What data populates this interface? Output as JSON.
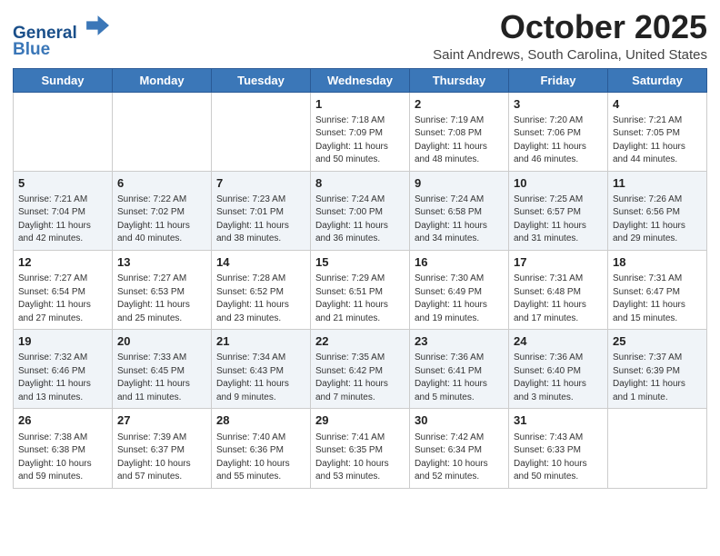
{
  "header": {
    "logo_line1": "General",
    "logo_line2": "Blue",
    "main_title": "October 2025",
    "subtitle": "Saint Andrews, South Carolina, United States"
  },
  "weekdays": [
    "Sunday",
    "Monday",
    "Tuesday",
    "Wednesday",
    "Thursday",
    "Friday",
    "Saturday"
  ],
  "weeks": [
    [
      {
        "day": "",
        "info": ""
      },
      {
        "day": "",
        "info": ""
      },
      {
        "day": "",
        "info": ""
      },
      {
        "day": "1",
        "info": "Sunrise: 7:18 AM\nSunset: 7:09 PM\nDaylight: 11 hours\nand 50 minutes."
      },
      {
        "day": "2",
        "info": "Sunrise: 7:19 AM\nSunset: 7:08 PM\nDaylight: 11 hours\nand 48 minutes."
      },
      {
        "day": "3",
        "info": "Sunrise: 7:20 AM\nSunset: 7:06 PM\nDaylight: 11 hours\nand 46 minutes."
      },
      {
        "day": "4",
        "info": "Sunrise: 7:21 AM\nSunset: 7:05 PM\nDaylight: 11 hours\nand 44 minutes."
      }
    ],
    [
      {
        "day": "5",
        "info": "Sunrise: 7:21 AM\nSunset: 7:04 PM\nDaylight: 11 hours\nand 42 minutes."
      },
      {
        "day": "6",
        "info": "Sunrise: 7:22 AM\nSunset: 7:02 PM\nDaylight: 11 hours\nand 40 minutes."
      },
      {
        "day": "7",
        "info": "Sunrise: 7:23 AM\nSunset: 7:01 PM\nDaylight: 11 hours\nand 38 minutes."
      },
      {
        "day": "8",
        "info": "Sunrise: 7:24 AM\nSunset: 7:00 PM\nDaylight: 11 hours\nand 36 minutes."
      },
      {
        "day": "9",
        "info": "Sunrise: 7:24 AM\nSunset: 6:58 PM\nDaylight: 11 hours\nand 34 minutes."
      },
      {
        "day": "10",
        "info": "Sunrise: 7:25 AM\nSunset: 6:57 PM\nDaylight: 11 hours\nand 31 minutes."
      },
      {
        "day": "11",
        "info": "Sunrise: 7:26 AM\nSunset: 6:56 PM\nDaylight: 11 hours\nand 29 minutes."
      }
    ],
    [
      {
        "day": "12",
        "info": "Sunrise: 7:27 AM\nSunset: 6:54 PM\nDaylight: 11 hours\nand 27 minutes."
      },
      {
        "day": "13",
        "info": "Sunrise: 7:27 AM\nSunset: 6:53 PM\nDaylight: 11 hours\nand 25 minutes."
      },
      {
        "day": "14",
        "info": "Sunrise: 7:28 AM\nSunset: 6:52 PM\nDaylight: 11 hours\nand 23 minutes."
      },
      {
        "day": "15",
        "info": "Sunrise: 7:29 AM\nSunset: 6:51 PM\nDaylight: 11 hours\nand 21 minutes."
      },
      {
        "day": "16",
        "info": "Sunrise: 7:30 AM\nSunset: 6:49 PM\nDaylight: 11 hours\nand 19 minutes."
      },
      {
        "day": "17",
        "info": "Sunrise: 7:31 AM\nSunset: 6:48 PM\nDaylight: 11 hours\nand 17 minutes."
      },
      {
        "day": "18",
        "info": "Sunrise: 7:31 AM\nSunset: 6:47 PM\nDaylight: 11 hours\nand 15 minutes."
      }
    ],
    [
      {
        "day": "19",
        "info": "Sunrise: 7:32 AM\nSunset: 6:46 PM\nDaylight: 11 hours\nand 13 minutes."
      },
      {
        "day": "20",
        "info": "Sunrise: 7:33 AM\nSunset: 6:45 PM\nDaylight: 11 hours\nand 11 minutes."
      },
      {
        "day": "21",
        "info": "Sunrise: 7:34 AM\nSunset: 6:43 PM\nDaylight: 11 hours\nand 9 minutes."
      },
      {
        "day": "22",
        "info": "Sunrise: 7:35 AM\nSunset: 6:42 PM\nDaylight: 11 hours\nand 7 minutes."
      },
      {
        "day": "23",
        "info": "Sunrise: 7:36 AM\nSunset: 6:41 PM\nDaylight: 11 hours\nand 5 minutes."
      },
      {
        "day": "24",
        "info": "Sunrise: 7:36 AM\nSunset: 6:40 PM\nDaylight: 11 hours\nand 3 minutes."
      },
      {
        "day": "25",
        "info": "Sunrise: 7:37 AM\nSunset: 6:39 PM\nDaylight: 11 hours\nand 1 minute."
      }
    ],
    [
      {
        "day": "26",
        "info": "Sunrise: 7:38 AM\nSunset: 6:38 PM\nDaylight: 10 hours\nand 59 minutes."
      },
      {
        "day": "27",
        "info": "Sunrise: 7:39 AM\nSunset: 6:37 PM\nDaylight: 10 hours\nand 57 minutes."
      },
      {
        "day": "28",
        "info": "Sunrise: 7:40 AM\nSunset: 6:36 PM\nDaylight: 10 hours\nand 55 minutes."
      },
      {
        "day": "29",
        "info": "Sunrise: 7:41 AM\nSunset: 6:35 PM\nDaylight: 10 hours\nand 53 minutes."
      },
      {
        "day": "30",
        "info": "Sunrise: 7:42 AM\nSunset: 6:34 PM\nDaylight: 10 hours\nand 52 minutes."
      },
      {
        "day": "31",
        "info": "Sunrise: 7:43 AM\nSunset: 6:33 PM\nDaylight: 10 hours\nand 50 minutes."
      },
      {
        "day": "",
        "info": ""
      }
    ]
  ]
}
